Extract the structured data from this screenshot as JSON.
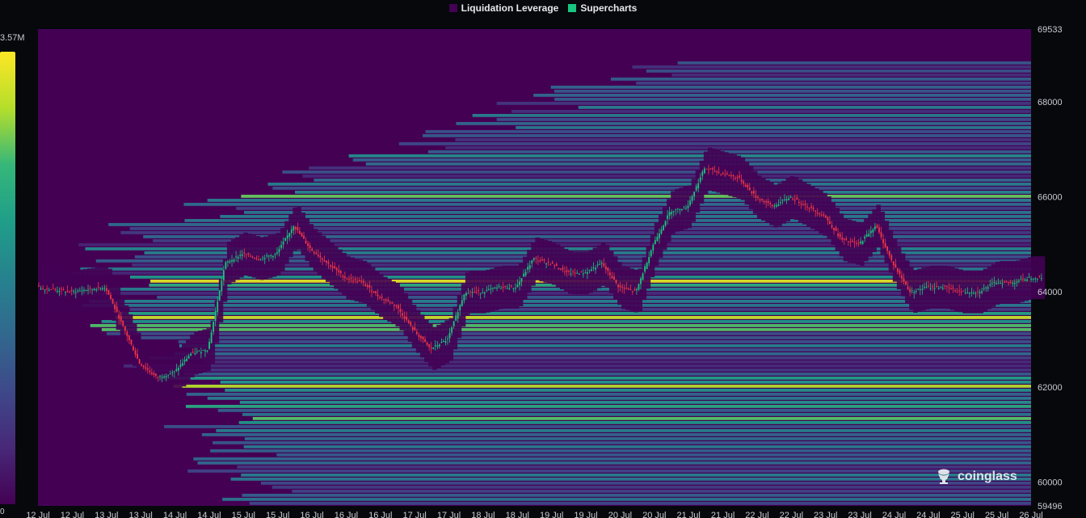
{
  "legend": {
    "items": [
      {
        "label": "Liquidation Leverage",
        "color": "#440154"
      },
      {
        "label": "Supercharts",
        "color": "#18c77e"
      }
    ]
  },
  "colorbar": {
    "max_label": "3.57M",
    "min_label": "0",
    "colors": [
      "#440154",
      "#482878",
      "#3e4989",
      "#31688e",
      "#26828e",
      "#1f9e89",
      "#35b779",
      "#b5de2b",
      "#fde725"
    ]
  },
  "watermark": {
    "text": "coinglass",
    "icon": "coinglass-logo-icon"
  },
  "chart_data": {
    "type": "heatmap",
    "title": "",
    "xlabel": "",
    "ylabel": "",
    "ylim": [
      59496,
      69533
    ],
    "y_ticks": [
      69533,
      68000,
      66000,
      64000,
      62000,
      60000,
      59496
    ],
    "x_ticks": [
      "12 Jul",
      "12 Jul",
      "13 Jul",
      "13 Jul",
      "14 Jul",
      "14 Jul",
      "15 Jul",
      "15 Jul",
      "16 Jul",
      "16 Jul",
      "16 Jul",
      "17 Jul",
      "17 Jul",
      "18 Jul",
      "18 Jul",
      "19 Jul",
      "19 Jul",
      "20 Jul",
      "20 Jul",
      "21 Jul",
      "21 Jul",
      "22 Jul",
      "22 Jul",
      "23 Jul",
      "23 Jul",
      "24 Jul",
      "24 Jul",
      "25 Jul",
      "25 Jul",
      "26 Jul"
    ],
    "price_series": {
      "name": "Supercharts",
      "x_index": [
        0,
        1,
        2,
        2.5,
        3,
        3.5,
        4,
        4.5,
        5,
        5.5,
        6,
        6.5,
        7,
        7.5,
        8,
        8.5,
        9,
        9.5,
        10,
        10.5,
        11,
        11.5,
        12,
        12.5,
        13,
        13.5,
        14,
        14.5,
        15,
        15.5,
        16,
        16.5,
        17,
        17.5,
        18,
        18.5,
        19,
        19.5,
        20,
        20.5,
        21,
        21.5,
        22,
        22.5,
        23,
        23.5,
        24,
        24.5,
        25,
        25.5,
        26,
        26.5,
        27,
        27.5,
        28,
        28.5,
        29,
        29.3
      ],
      "values": [
        64100,
        64000,
        64100,
        63300,
        62500,
        62200,
        62300,
        62700,
        62800,
        64600,
        64800,
        64700,
        64800,
        65400,
        64900,
        64600,
        64300,
        64200,
        63900,
        63700,
        63200,
        62800,
        63000,
        64000,
        64000,
        64100,
        64100,
        64700,
        64600,
        64400,
        64400,
        64600,
        64100,
        64000,
        65000,
        65700,
        65800,
        66600,
        66500,
        66400,
        66000,
        65800,
        66000,
        65800,
        65600,
        65100,
        65000,
        65400,
        64600,
        64000,
        64100,
        64100,
        64000,
        64000,
        64200,
        64200,
        64300,
        64300
      ],
      "color_up": "#18c77e",
      "color_down": "#f23645"
    },
    "heat_levels": [
      {
        "price": 64250,
        "intensity": 1.0
      },
      {
        "price": 63500,
        "intensity": 0.95
      },
      {
        "price": 63280,
        "intensity": 0.92
      },
      {
        "price": 62050,
        "intensity": 0.9
      },
      {
        "price": 61350,
        "intensity": 0.8
      },
      {
        "price": 61650,
        "intensity": 0.7
      },
      {
        "price": 62200,
        "intensity": 0.62
      },
      {
        "price": 66050,
        "intensity": 0.78
      },
      {
        "price": 64150,
        "intensity": 0.62
      },
      {
        "price": 63800,
        "intensity": 0.55
      },
      {
        "price": 66900,
        "intensity": 0.5
      },
      {
        "price": 67500,
        "intensity": 0.42
      },
      {
        "price": 65500,
        "intensity": 0.48
      },
      {
        "price": 64900,
        "intensity": 0.58
      },
      {
        "price": 62900,
        "intensity": 0.45
      },
      {
        "price": 60100,
        "intensity": 0.42
      },
      {
        "price": 60650,
        "intensity": 0.38
      }
    ]
  }
}
